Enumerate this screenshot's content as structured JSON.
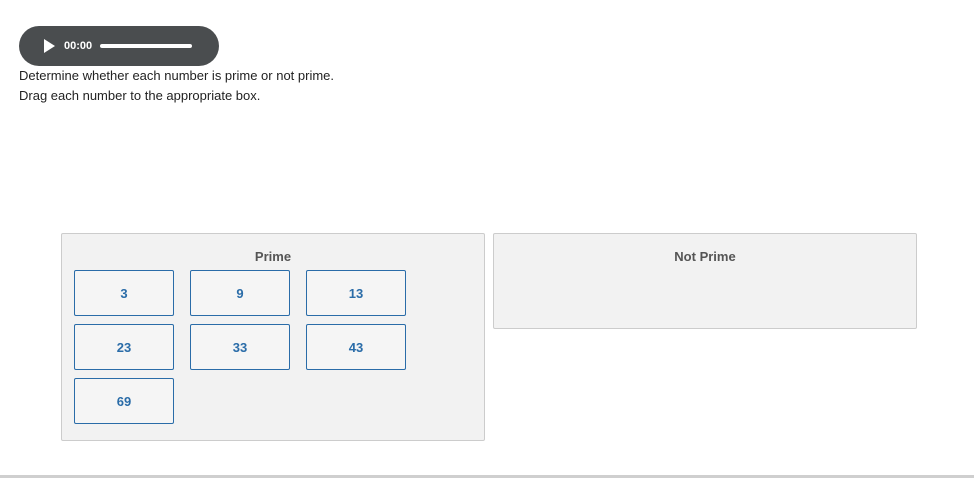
{
  "audio_player": {
    "time": "00:00",
    "progress": 1.0,
    "play_icon": "play-icon"
  },
  "instructions": [
    "Determine whether each number is prime or not prime.",
    "Drag each number to the appropriate box."
  ],
  "zones": {
    "prime": {
      "title": "Prime",
      "tiles": [
        "3",
        "9",
        "13",
        "23",
        "33",
        "43",
        "69"
      ]
    },
    "not_prime": {
      "title": "Not Prime",
      "tiles": []
    }
  },
  "colors": {
    "tile_accent": "#2a6ca8",
    "zone_background": "#f2f2f2",
    "player_background": "#4a4d4f"
  }
}
